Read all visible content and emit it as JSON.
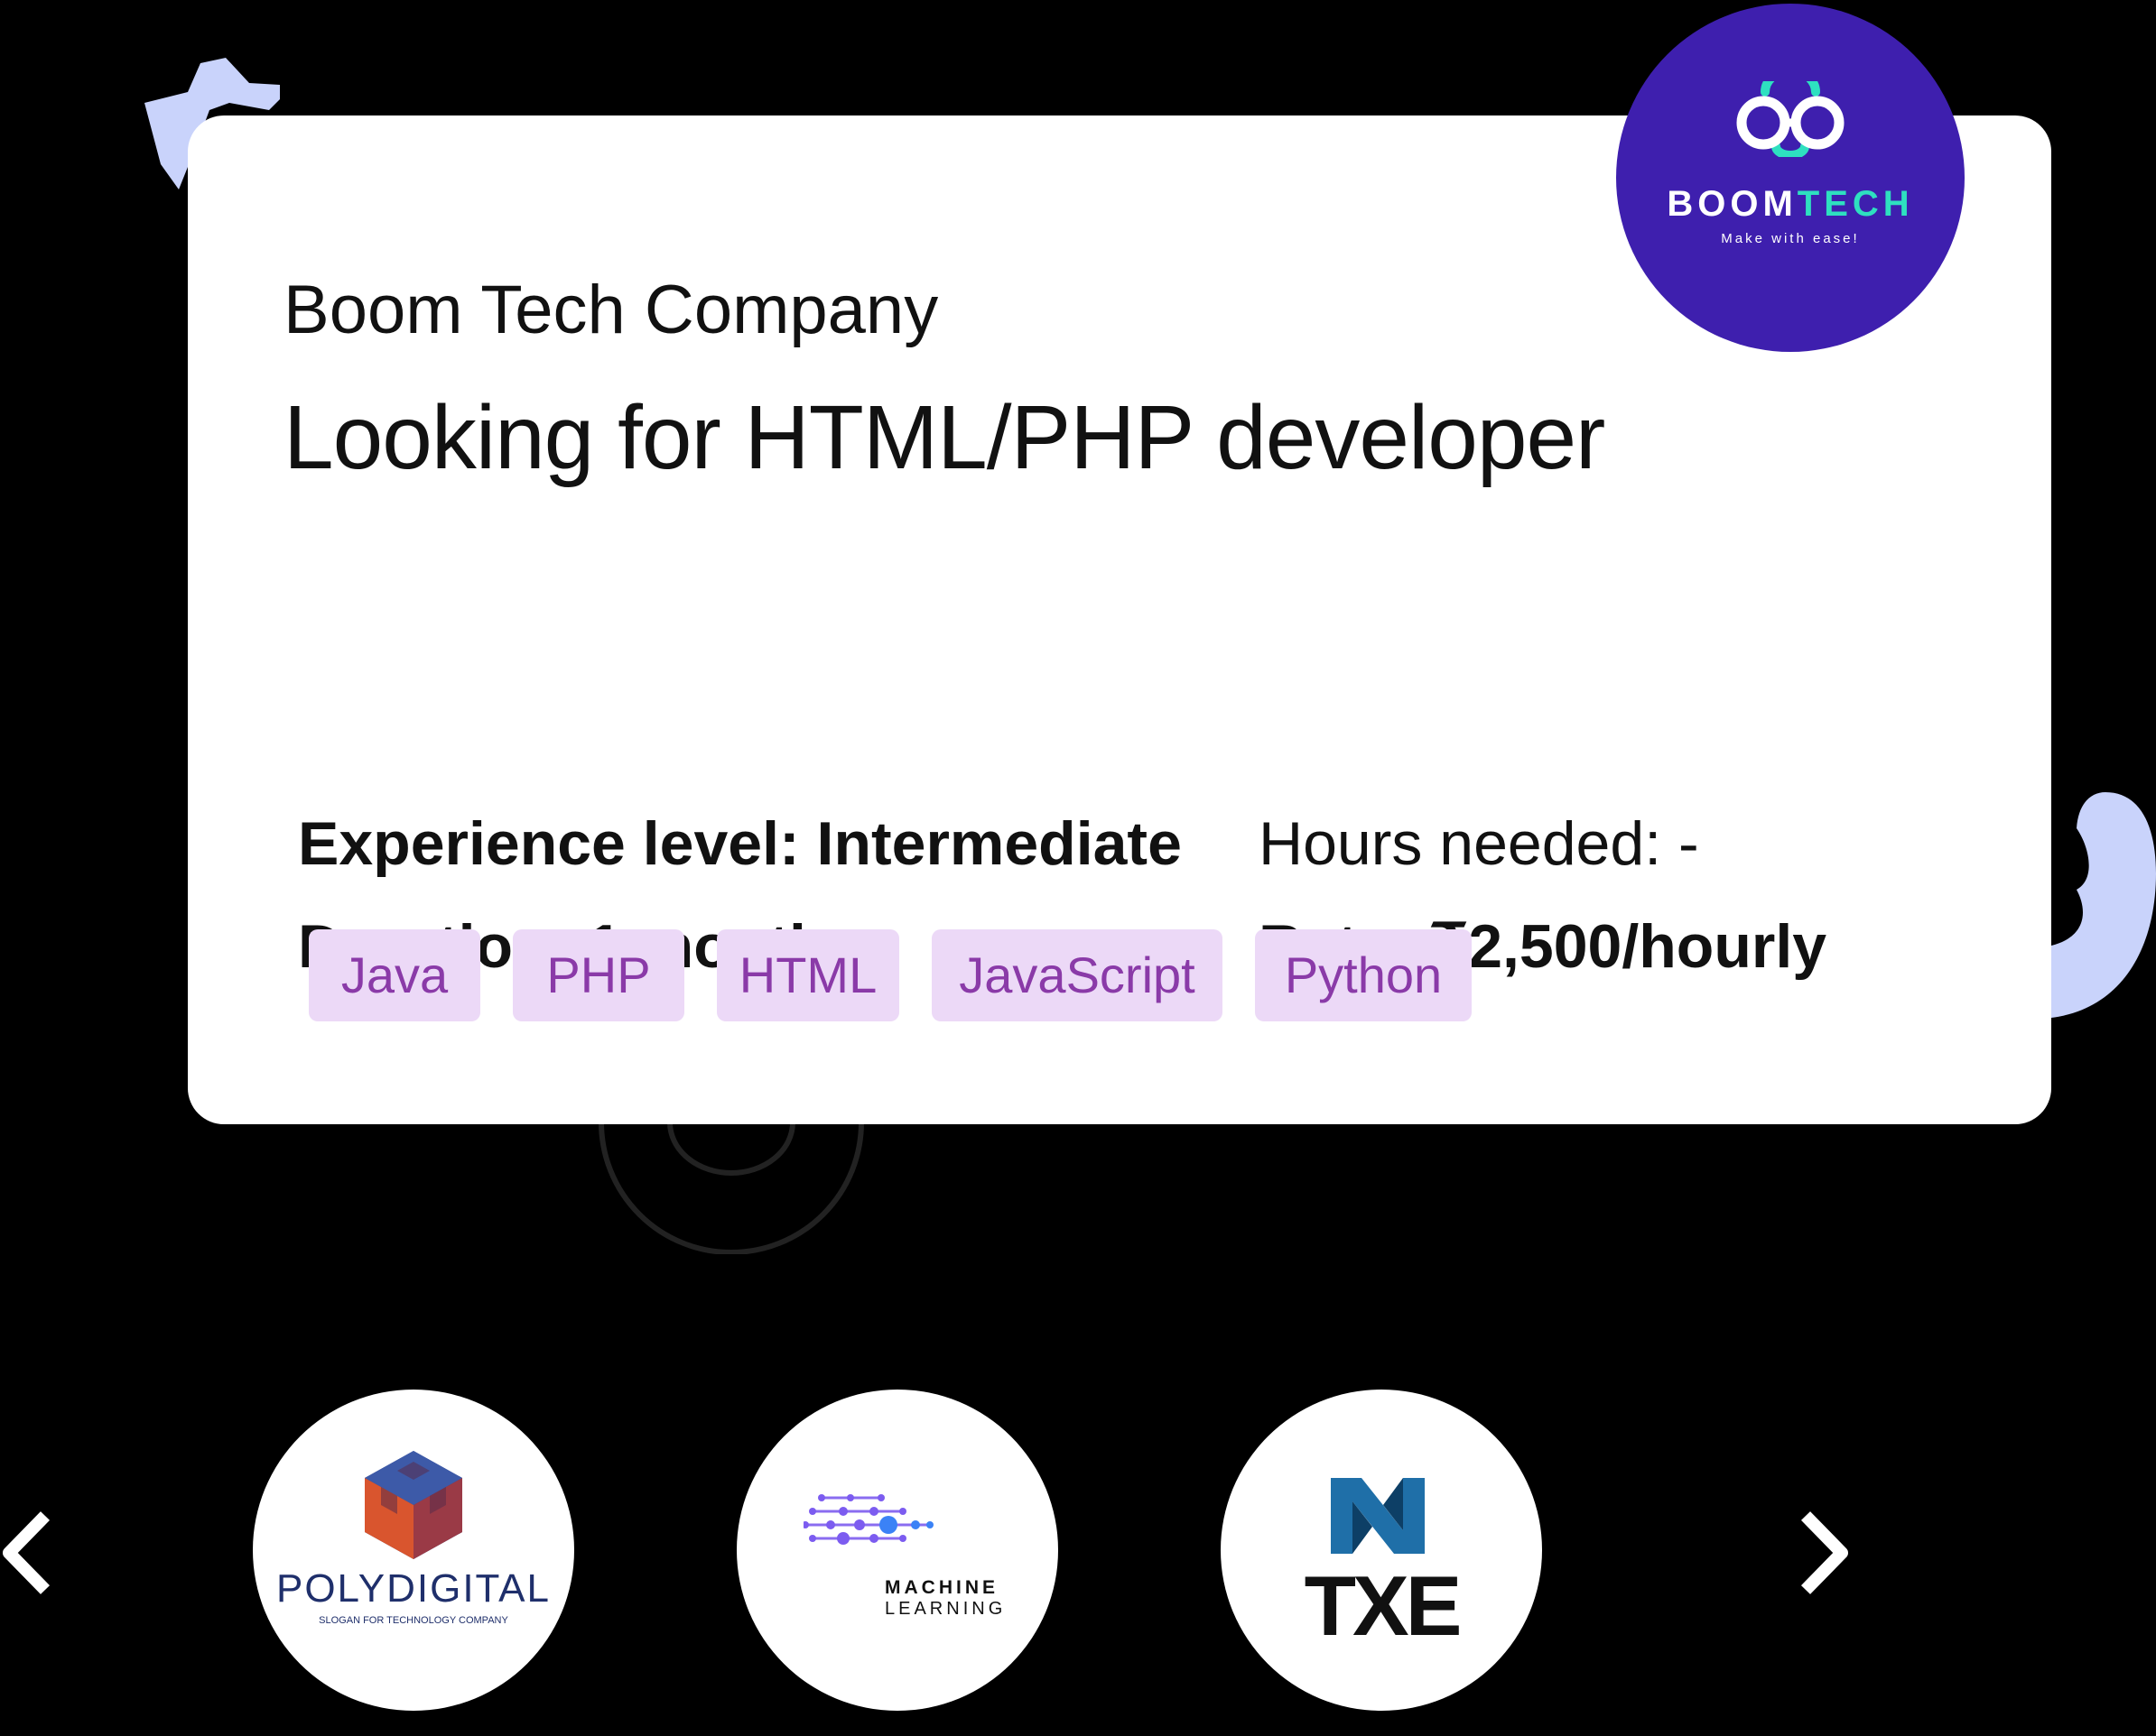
{
  "job": {
    "company": "Boom Tech Company",
    "title": "Looking for HTML/PHP developer",
    "experience": "Experience level: Intermediate",
    "hours": "Hours needed:  -",
    "duration": "Duration: 1 month",
    "rate": "Rate: ₹2,500/hourly",
    "skills": [
      "Java",
      "PHP",
      "HTML",
      "JavaScript",
      "Python"
    ]
  },
  "brand_logo": {
    "name_part1": "BOOM",
    "name_part2": "TECH",
    "slogan": "Make with ease!",
    "icon": "glasses-icon",
    "background": "#3e1fae",
    "accent": "#2ee0c0"
  },
  "carousel": {
    "prev_icon": "chevron-left-icon",
    "next_icon": "chevron-right-icon",
    "partners": [
      {
        "name": "POLYDIGITAL",
        "slogan": "SLOGAN FOR TECHNOLOGY COMPANY",
        "icon": "cube-hexagon-icon"
      },
      {
        "name": "MACHINE",
        "name2": "LEARNING",
        "icon": "neural-network-icon"
      },
      {
        "name": "TXE",
        "icon": "txe-knot-icon"
      }
    ]
  },
  "colors": {
    "tag_background": "#ecd9f7",
    "tag_text": "#8a3aa8",
    "decor_shape": "#c9d3fb"
  }
}
